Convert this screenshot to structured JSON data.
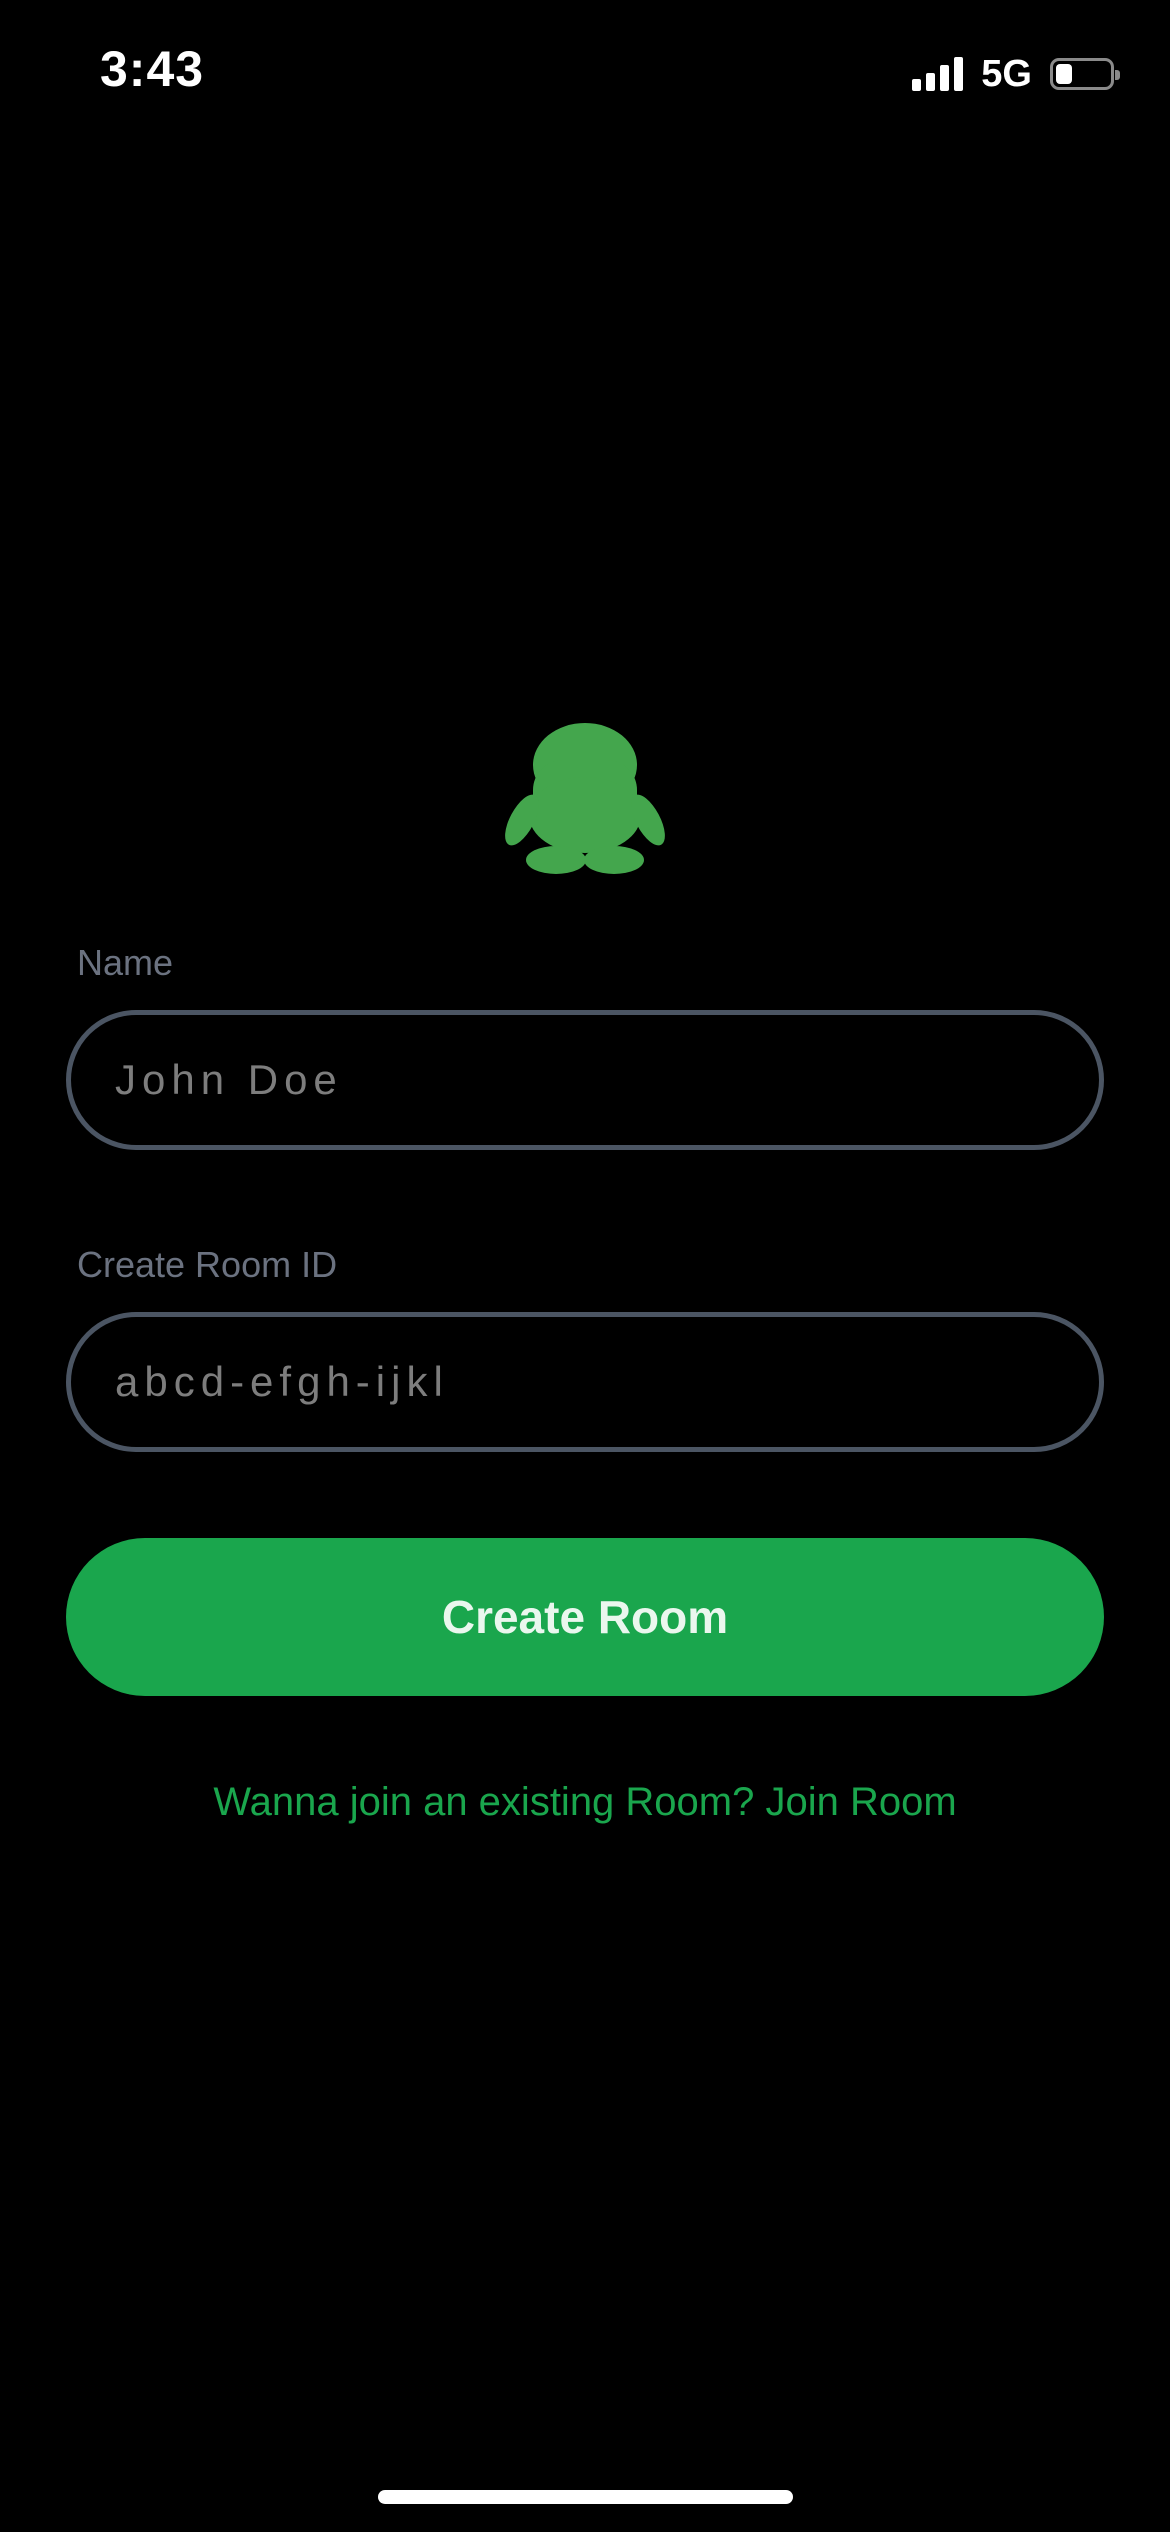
{
  "status_bar": {
    "time": "3:43",
    "network": "5G",
    "signal_icon": "cellular-signal-icon",
    "battery_icon": "battery-icon",
    "battery_level": 0.3
  },
  "logo": {
    "icon": "penguin-logo-icon",
    "color": "#44a64d"
  },
  "form": {
    "name_label": "Name",
    "name_placeholder": "John Doe",
    "room_label": "Create Room ID",
    "room_placeholder": "abcd-efgh-ijkl",
    "submit_label": "Create Room"
  },
  "join_link": {
    "text": "Wanna join an existing Room? Join Room"
  },
  "colors": {
    "background": "#000000",
    "accent": "#1aa64d",
    "border": "#4b5563",
    "label": "#6b7280"
  }
}
